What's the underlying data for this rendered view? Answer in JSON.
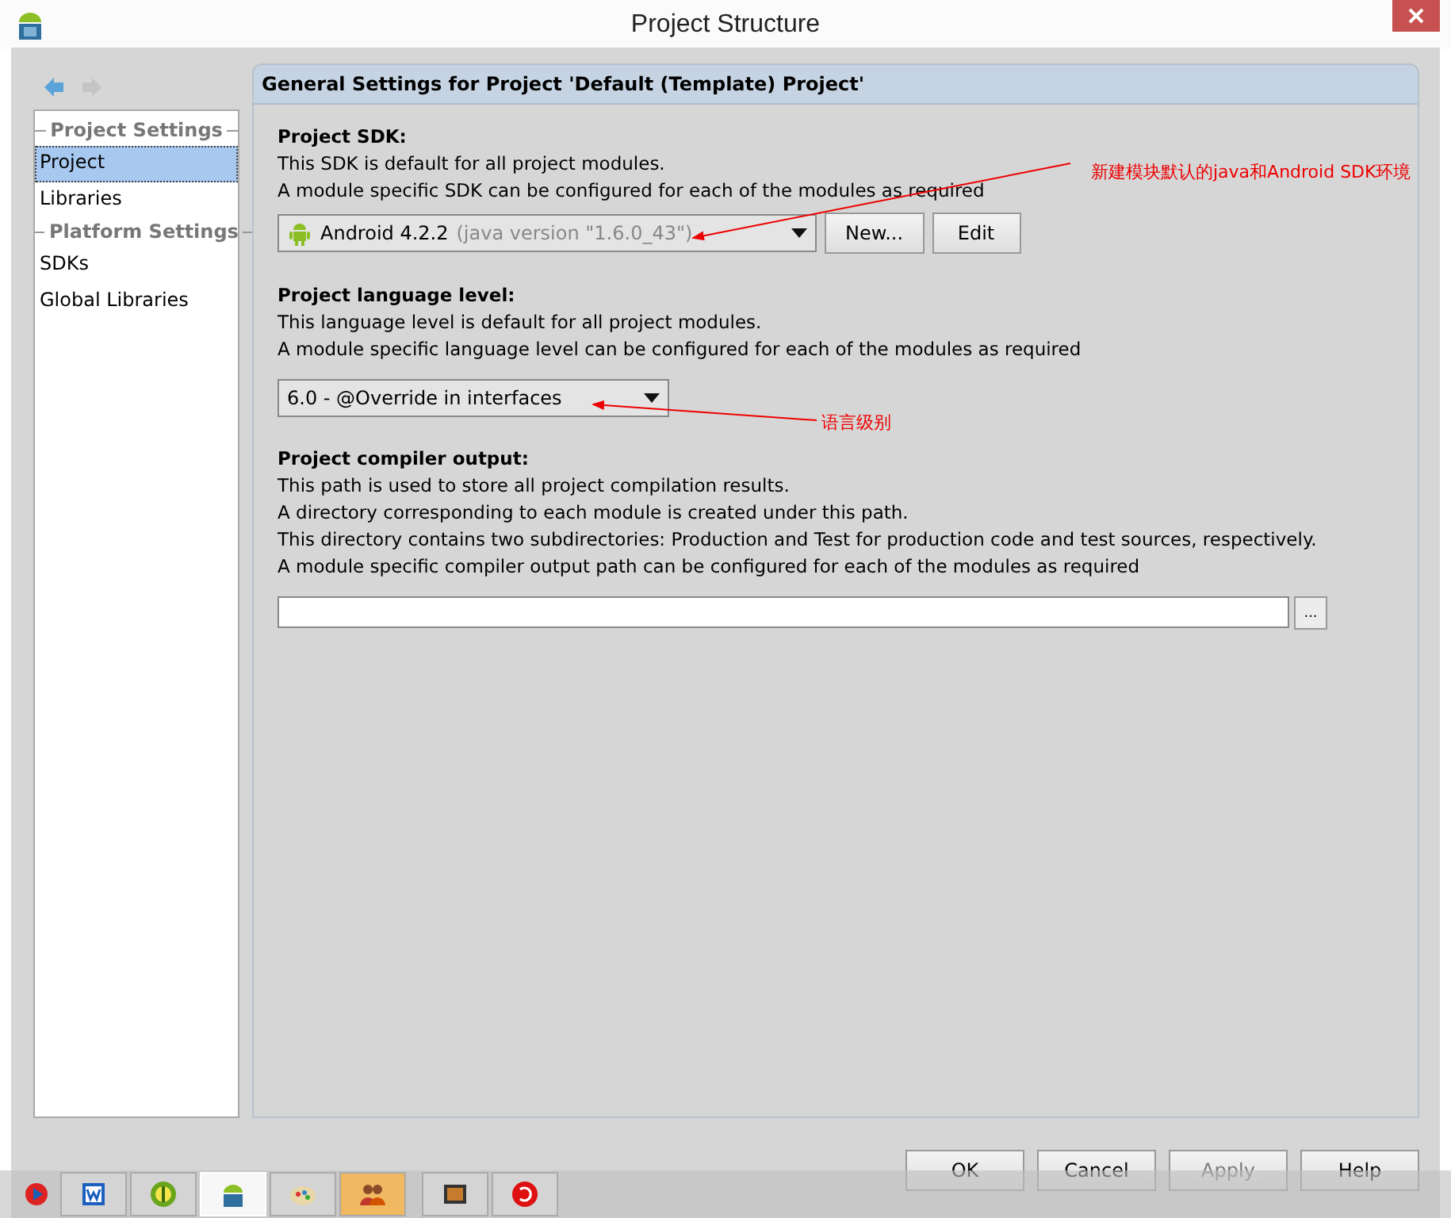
{
  "window": {
    "title": "Project Structure"
  },
  "sidebar": {
    "groups": [
      {
        "title": "Project Settings",
        "items": [
          {
            "label": "Project",
            "selected": true
          },
          {
            "label": "Libraries",
            "selected": false
          }
        ]
      },
      {
        "title": "Platform Settings",
        "items": [
          {
            "label": "SDKs",
            "selected": false
          },
          {
            "label": "Global Libraries",
            "selected": false
          }
        ]
      }
    ]
  },
  "panel": {
    "title": "General Settings for Project 'Default (Template) Project'",
    "sections": [
      {
        "kind": "sdk",
        "heading": "Project SDK:",
        "lines": [
          "This SDK is default for all project modules.",
          "A module specific SDK can be configured for each of the modules as required"
        ],
        "value": "Android 4.2.2",
        "hint": "(java version \"1.6.0_43\")",
        "buttons": [
          "New...",
          "Edit"
        ]
      },
      {
        "kind": "level",
        "heading": "Project language level:",
        "lines": [
          "This language level is default for all project modules.",
          "A module specific language level can be configured for each of the modules as required"
        ],
        "value": "6.0 - @Override in interfaces"
      },
      {
        "kind": "path",
        "heading": "Project compiler output:",
        "lines": [
          "This path is used to store all project compilation results.",
          "A directory corresponding to each module is created under this path.",
          "This directory contains two subdirectories: Production and Test for production code and test sources, respectively.",
          "A module specific compiler output path can be configured for each of the modules as required"
        ],
        "browse": "..."
      }
    ]
  },
  "buttons": [
    {
      "label": "OK",
      "disabled": false
    },
    {
      "label": "Cancel",
      "disabled": false
    },
    {
      "label": "Apply",
      "disabled": true
    },
    {
      "label": "Help",
      "disabled": false
    }
  ],
  "annotations": [
    {
      "text": "新建模块默认的java和Android SDK环境"
    },
    {
      "text": "语言级别"
    }
  ],
  "taskbar": {
    "items": [
      {
        "kind": "player",
        "selected": false
      },
      {
        "kind": "word",
        "selected": false
      },
      {
        "kind": "bracket",
        "selected": false
      },
      {
        "kind": "android",
        "selected": true
      },
      {
        "kind": "paint",
        "selected": false
      },
      {
        "kind": "people",
        "selected": false
      },
      {
        "kind": "terminal",
        "selected": false
      },
      {
        "kind": "swirl",
        "selected": false
      }
    ]
  }
}
